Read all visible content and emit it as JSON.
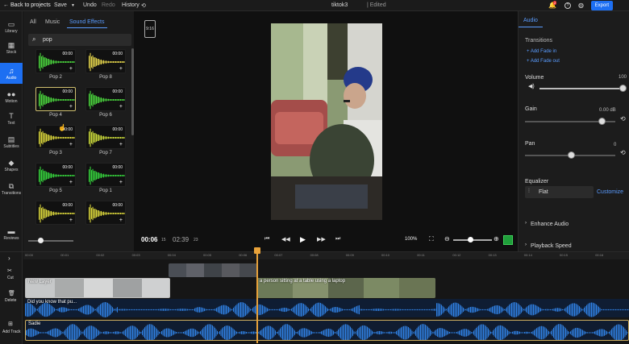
{
  "topbar": {
    "back": "Back to projects",
    "save": "Save",
    "undo": "Undo",
    "redo": "Redo",
    "history": "History",
    "project_name": "tiktok3",
    "edited": "| Edited",
    "notif_count": "2",
    "export": "Export"
  },
  "leftnav": {
    "items": [
      {
        "label": "Library",
        "icon": "folder-icon"
      },
      {
        "label": "Stock",
        "icon": "stock-icon"
      },
      {
        "label": "Audio",
        "icon": "music-note-icon"
      },
      {
        "label": "Motion",
        "icon": "motion-icon"
      },
      {
        "label": "Text",
        "icon": "text-icon"
      },
      {
        "label": "Subtitles",
        "icon": "subtitles-icon"
      },
      {
        "label": "Shapes",
        "icon": "shapes-icon"
      },
      {
        "label": "Transitions",
        "icon": "transitions-icon"
      },
      {
        "label": "Reviews",
        "icon": "chat-icon"
      }
    ]
  },
  "media": {
    "tabs": [
      "All",
      "Music",
      "Sound Effects"
    ],
    "search_value": "pop",
    "effects": [
      {
        "name": "Pop 2",
        "duration": "00:00",
        "color": "#49d13c"
      },
      {
        "name": "Pop 8",
        "duration": "00:00",
        "color": "#e0d04a"
      },
      {
        "name": "Pop 4",
        "duration": "00:00",
        "color": "#49d13c"
      },
      {
        "name": "Pop 6",
        "duration": "00:00",
        "color": "#49d13c"
      },
      {
        "name": "Pop 3",
        "duration": "00:00",
        "color": "#d6d23a"
      },
      {
        "name": "Pop 7",
        "duration": "00:00",
        "color": "#c9d83a"
      },
      {
        "name": "Pop 5",
        "duration": "00:00",
        "color": "#35d03c"
      },
      {
        "name": "Pop 1",
        "duration": "00:00",
        "color": "#35d03c"
      },
      {
        "name": "",
        "duration": "00:00",
        "color": "#d6d23a"
      },
      {
        "name": "",
        "duration": "00:00",
        "color": "#d6d23a"
      }
    ]
  },
  "preview": {
    "aspect": "9:16",
    "current_time": "00:06",
    "current_frames": "15",
    "total_time": "02:39",
    "total_frames": "23",
    "zoom": "100%"
  },
  "audio_panel": {
    "tab": "Audio",
    "transitions_title": "Transitions",
    "fade_in": "Add Fade in",
    "fade_out": "Add Fade out",
    "volume_label": "Volume",
    "volume_value": "100",
    "volume_level": 1.0,
    "gain_label": "Gain",
    "gain_value": "0.00 dB",
    "pan_label": "Pan",
    "pan_value": "0",
    "equalizer_label": "Equalizer",
    "equalizer_value": "Flat",
    "customize": "Customize",
    "enhance_audio": "Enhance Audio",
    "playback_speed": "Playback Speed"
  },
  "timeline": {
    "nav": [
      "Cut",
      "Delete",
      "Add Track"
    ],
    "ruler": [
      "00:00",
      "00:01",
      "00:02",
      "00:03",
      "00:04",
      "00:05",
      "00:06",
      "00:07",
      "00:08",
      "00:09",
      "00:10",
      "00:11",
      "00:12",
      "00:13",
      "00:14",
      "00:15",
      "00:16"
    ],
    "clips": {
      "layer1": "New Layer",
      "layer2": "a person sitting at a table using a laptop",
      "audio1": "Did you know that pu...",
      "audio2": "Sadie"
    }
  },
  "colors": {
    "accent": "#1d6ff2",
    "playhead": "#e8a23a",
    "waveform": "#2f7fe0"
  }
}
